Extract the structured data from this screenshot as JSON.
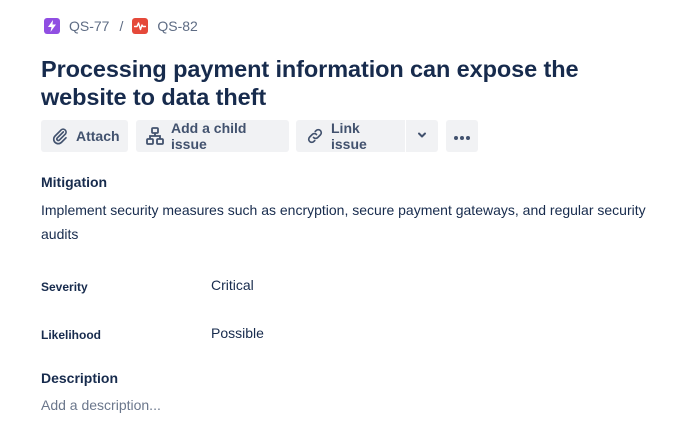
{
  "breadcrumb": {
    "parent": {
      "key": "QS-77",
      "icon": "lightning-icon",
      "color": "#904ee2"
    },
    "separator": "/",
    "current": {
      "key": "QS-82",
      "icon": "pulse-icon",
      "color": "#e5493a"
    }
  },
  "issue": {
    "title": "Processing payment information can expose the website to data theft"
  },
  "toolbar": {
    "attach_label": "Attach",
    "add_child_label": "Add a child issue",
    "link_issue_label": "Link issue"
  },
  "mitigation": {
    "label": "Mitigation",
    "text": "Implement security measures such as encryption, secure payment gateways, and regular security audits"
  },
  "fields": {
    "severity": {
      "label": "Severity",
      "value": "Critical"
    },
    "likelihood": {
      "label": "Likelihood",
      "value": "Possible"
    }
  },
  "description": {
    "label": "Description",
    "placeholder": "Add a description..."
  },
  "colors": {
    "text": "#172b4d",
    "subtle": "#5e6c84",
    "button_bg": "#f1f2f4"
  }
}
